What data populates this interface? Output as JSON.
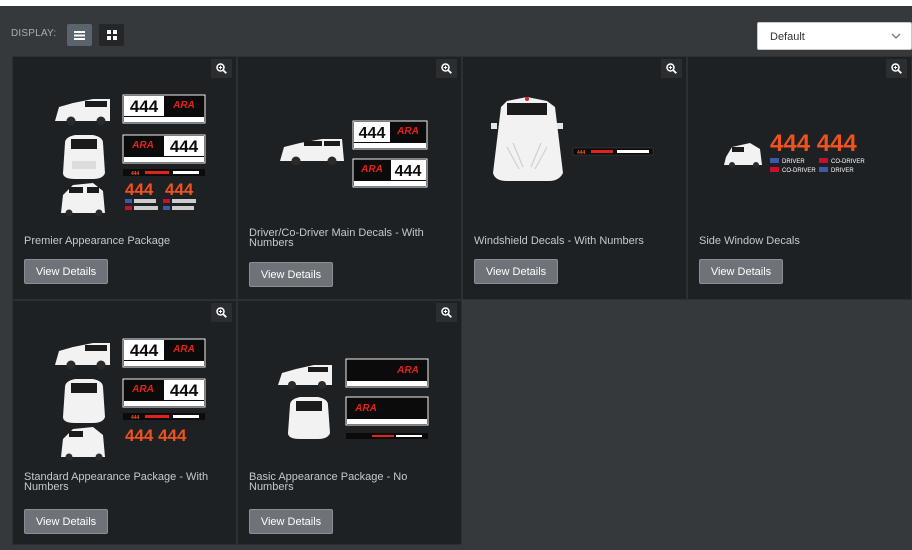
{
  "toolbar": {
    "display_label": "DISPLAY:",
    "list_view_icon": "list-view-icon",
    "grid_view_icon": "grid-view-icon",
    "sort_value": "Default",
    "sort_icon": "chevron-down-icon"
  },
  "products": [
    {
      "title": "Premier Appearance Package",
      "button": "View Details",
      "zoom_icon": "zoom-in-icon",
      "decal": {
        "number": "444",
        "brand": "ARA",
        "tag_text": "444",
        "rows": [
          [
            "DRIVER",
            "CO-DRIVER"
          ],
          [
            "CO-DRIVER",
            "DRIVER"
          ]
        ]
      }
    },
    {
      "title": "Driver/Co-Driver Main Decals - With Numbers",
      "button": "View Details",
      "zoom_icon": "zoom-in-icon",
      "decal": {
        "number": "444",
        "brand": "ARA"
      }
    },
    {
      "title": "Windshield Decals - With Numbers",
      "button": "View Details",
      "zoom_icon": "zoom-in-icon",
      "decal": {
        "tag_text": "444"
      }
    },
    {
      "title": "Side Window Decals",
      "button": "View Details",
      "zoom_icon": "zoom-in-icon",
      "decal": {
        "big": "444 444",
        "rows": [
          [
            "DRIVER",
            "CO-DRIVER"
          ],
          [
            "CO-DRIVER",
            "DRIVER"
          ]
        ]
      }
    },
    {
      "title": "Standard Appearance Package - With Numbers",
      "button": "View Details",
      "zoom_icon": "zoom-in-icon",
      "decal": {
        "number": "444",
        "brand": "ARA",
        "big": "444 444",
        "tag_text": "444"
      }
    },
    {
      "title": "Basic Appearance Package - No Numbers",
      "button": "View Details",
      "zoom_icon": "zoom-in-icon",
      "decal": {
        "brand": "ARA"
      }
    }
  ],
  "colors": {
    "page_bg": "#36393c",
    "card_bg": "#1e2124",
    "button_bg": "#6e737a",
    "decal_orange": "#f0521e",
    "decal_red": "#e2231a"
  }
}
